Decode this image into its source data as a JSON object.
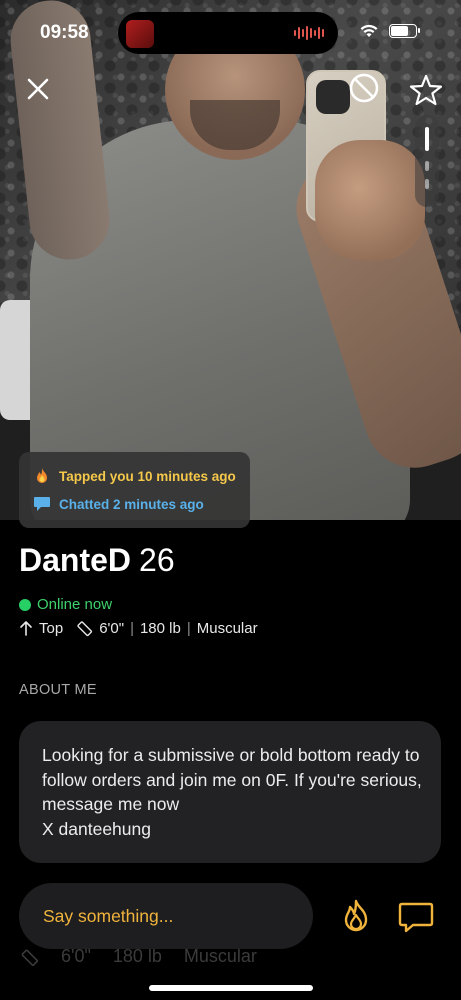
{
  "status": {
    "time": "09:58",
    "battery_level": 0.75
  },
  "photo": {
    "close_icon": "close-icon",
    "block_icon": "block-icon",
    "favorite_icon": "star-icon"
  },
  "activity": {
    "tapped": "Tapped you 10 minutes ago",
    "chatted": "Chatted 2 minutes ago"
  },
  "profile": {
    "name": "DanteD",
    "age": "26",
    "online": "Online now",
    "position": "Top",
    "height": "6'0\"",
    "weight": "180 lb",
    "body": "Muscular",
    "about_heading": "ABOUT ME",
    "about_text": "Looking for a submissive or bold bottom ready to follow orders and join me on 0F. If you're serious, message me now\nX danteehung"
  },
  "ghost": {
    "height": "6'0\"",
    "weight": "180 lb",
    "body": "Muscular"
  },
  "chat": {
    "placeholder": "Say something..."
  },
  "colors": {
    "accent_yellow": "#f0b33b",
    "online_green": "#27d064",
    "chat_blue": "#5ab1ea"
  }
}
